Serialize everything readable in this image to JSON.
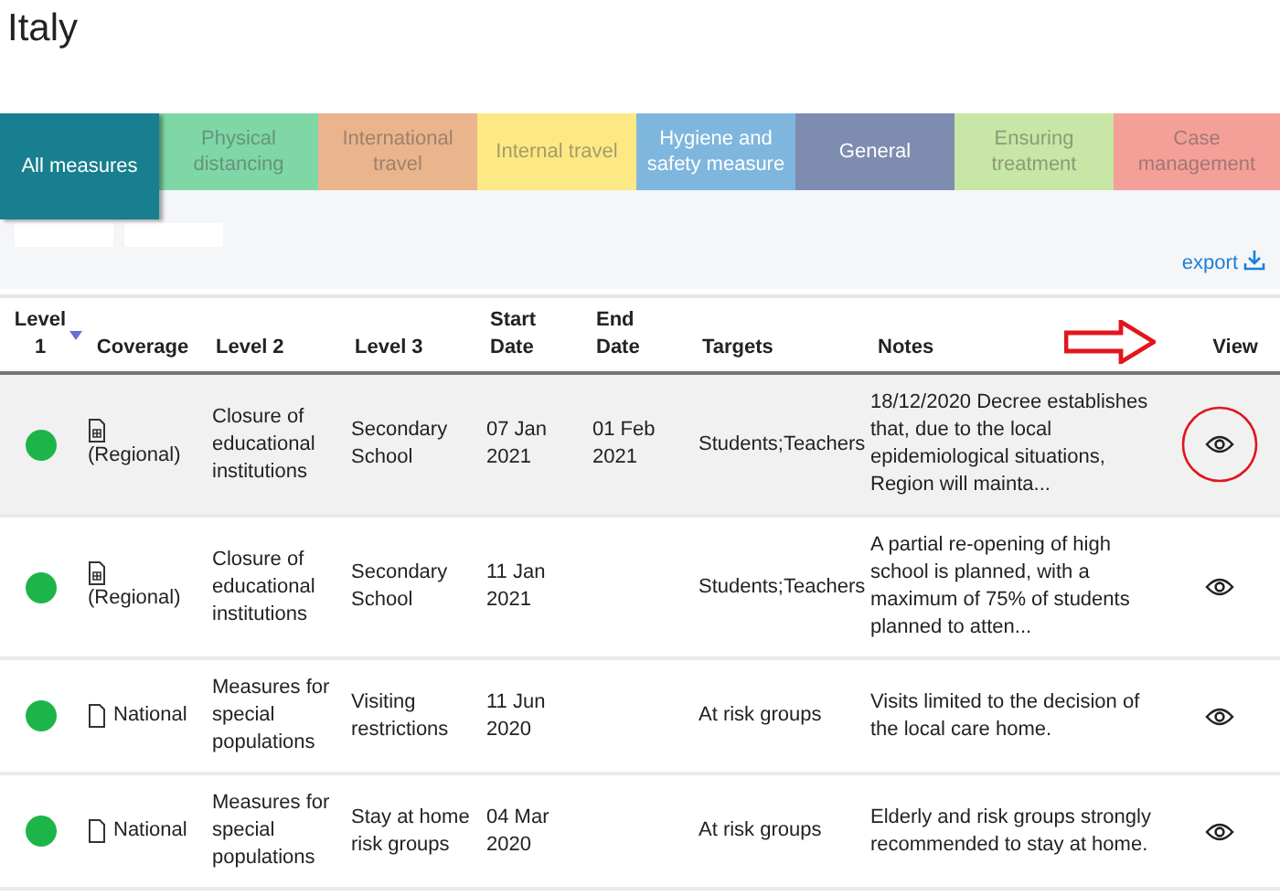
{
  "page": {
    "title": "Italy"
  },
  "tabs": [
    {
      "label": "All measures",
      "color": "#177f8f",
      "selected": true,
      "dimmed": false
    },
    {
      "label": "Physical distancing",
      "color": "#7fd7a6",
      "selected": false,
      "dimmed": true
    },
    {
      "label": "International travel",
      "color": "#eab48c",
      "selected": false,
      "dimmed": true
    },
    {
      "label": "Internal travel",
      "color": "#fde984",
      "selected": false,
      "dimmed": true
    },
    {
      "label": "Hygiene and safety measure",
      "color": "#7fb6de",
      "selected": false,
      "dimmed": false
    },
    {
      "label": "General",
      "color": "#7d8caf",
      "selected": false,
      "dimmed": false
    },
    {
      "label": "Ensuring treatment",
      "color": "#c8e6a5",
      "selected": false,
      "dimmed": true
    },
    {
      "label": "Case management",
      "color": "#f4a098",
      "selected": false,
      "dimmed": true
    }
  ],
  "toolbar": {
    "export": "export"
  },
  "table": {
    "columns": [
      {
        "label": "Level 1",
        "sorted": true
      },
      {
        "label": "Coverage",
        "sorted": false
      },
      {
        "label": "Level 2",
        "sorted": false
      },
      {
        "label": "Level 3",
        "sorted": false
      },
      {
        "label": "Start Date",
        "sorted": false
      },
      {
        "label": "End Date",
        "sorted": false
      },
      {
        "label": "Targets",
        "sorted": false
      },
      {
        "label": "Notes",
        "sorted": false
      },
      {
        "label": "View",
        "sorted": false
      }
    ],
    "rows": [
      {
        "color": "#1db54a",
        "kind": "regional",
        "coverage": "(Regional)",
        "level_2": "Closure of educational institutions",
        "level_3": "Secondary School",
        "start_date": "07 Jan 2021",
        "end_date": "01 Feb 2021",
        "targets": "Students;Teachers",
        "notes": "18/12/2020 Decree establishes that, due to the local epidemiological situations, Region will mainta...",
        "highlighted": true
      },
      {
        "color": "#1db54a",
        "kind": "regional",
        "coverage": "(Regional)",
        "level_2": "Closure of educational institutions",
        "level_3": "Secondary School",
        "start_date": "11 Jan 2021",
        "targets": "Students;Teachers",
        "notes": "A partial re-opening of high school is planned, with a maximum of 75% of students planned to atten...",
        "highlighted": false
      },
      {
        "color": "#1db54a",
        "kind": "national",
        "coverage": "National",
        "level_2": "Measures for special populations",
        "level_3": "Visiting restrictions",
        "start_date": "11 Jun 2020",
        "targets": "At risk groups",
        "notes": "Visits limited to the decision of the local care home.",
        "highlighted": false
      },
      {
        "color": "#1db54a",
        "kind": "national",
        "coverage": "National",
        "level_2": "Measures for special populations",
        "level_3": "Stay at home risk groups",
        "start_date": "04 Mar 2020",
        "targets": "At risk groups",
        "notes": "Elderly and risk groups strongly recommended to stay at home.",
        "highlighted": false
      }
    ]
  }
}
